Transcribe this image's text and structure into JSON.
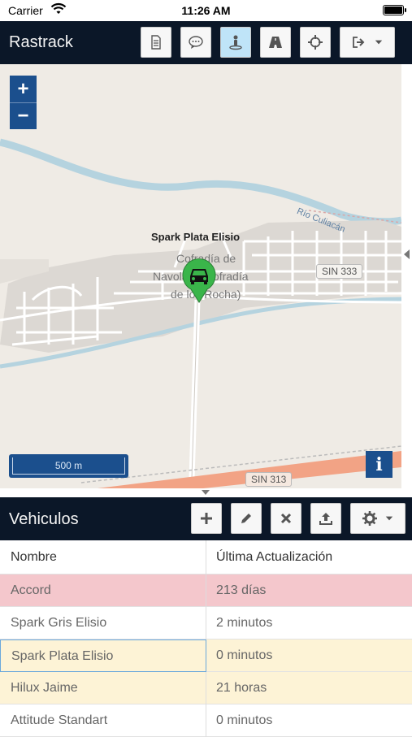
{
  "statusbar": {
    "carrier": "Carrier",
    "time": "11:26 AM"
  },
  "header": {
    "title": "Rastrack",
    "buttons": [
      {
        "name": "report-button",
        "icon": "document-icon"
      },
      {
        "name": "messages-button",
        "icon": "chat-bubble-icon"
      },
      {
        "name": "street-view-button",
        "icon": "person-pin-icon",
        "active": true
      },
      {
        "name": "routes-button",
        "icon": "road-icon"
      },
      {
        "name": "locate-button",
        "icon": "crosshair-icon"
      },
      {
        "name": "logout-menu-button",
        "icon": "sign-out-icon"
      }
    ]
  },
  "map": {
    "zoom_in": "+",
    "zoom_out": "−",
    "marker_label": "Spark Plata Elisio",
    "place_label_1": "Cofradía de",
    "place_label_2": "Navolato (Cofradía",
    "place_label_3": "de los Rocha)",
    "river_label": "Río Culiacán",
    "road_label_1": "SIN 333",
    "road_label_2": "SIN 313",
    "scale": "500 m",
    "info": "i",
    "marker_color": "#3ab54a"
  },
  "vehicles": {
    "title": "Vehiculos",
    "columns": [
      "Nombre",
      "Última Actualización"
    ],
    "rows": [
      {
        "name": "Accord",
        "updated": "213 días",
        "status": "alert"
      },
      {
        "name": "Spark Gris Elisio",
        "updated": "2 minutos",
        "status": "plain"
      },
      {
        "name": "Spark Plata Elisio",
        "updated": "0 minutos",
        "status": "warn"
      },
      {
        "name": "Hilux Jaime",
        "updated": "21 horas",
        "status": "warn"
      },
      {
        "name": "Attitude Standart",
        "updated": "0 minutos",
        "status": "plain"
      }
    ]
  },
  "colors": {
    "bar": "#0b1728",
    "accent": "#1b4f8d",
    "alert": "#f4c7cc",
    "warn": "#fdf3d6"
  }
}
